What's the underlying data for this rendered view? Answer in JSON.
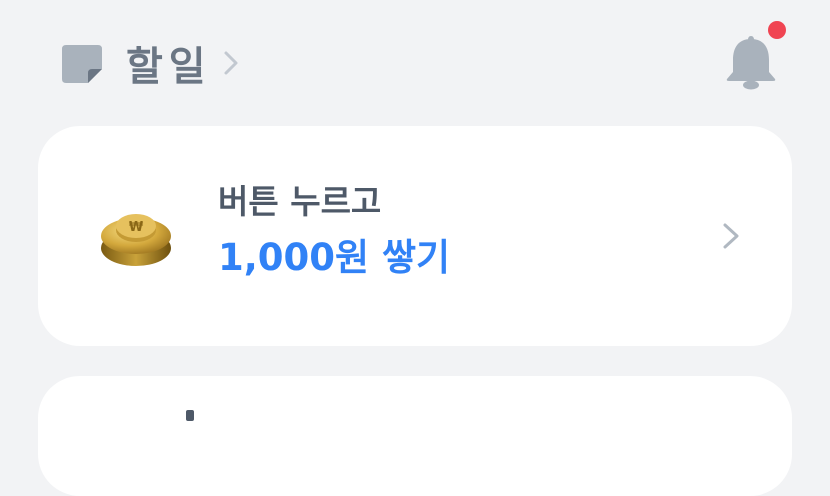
{
  "header": {
    "title": "할일",
    "icons": {
      "memo": "memo-icon",
      "chevron": "chevron-right-icon",
      "bell": "bell-icon"
    },
    "notification_dot_color": "#f04452"
  },
  "reward_card": {
    "subtitle": "버튼 누르고",
    "headline": "1,000원 쌓기",
    "icon": "gold-coin-button-icon",
    "accent_color": "#3182f6"
  }
}
